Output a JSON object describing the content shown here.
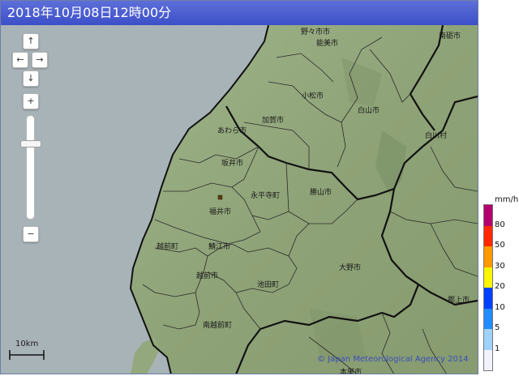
{
  "header": {
    "timestamp": "2018年10月08日12時00分"
  },
  "controls": {
    "pan_up": "↑",
    "pan_left": "←",
    "pan_right": "→",
    "pan_down": "↓",
    "zoom_in": "+",
    "zoom_out": "−",
    "zoom_level": 0.74
  },
  "scale": {
    "label": "10km"
  },
  "credit": "© Japan Meteorological Agency 2014",
  "legend": {
    "unit": "mm/h",
    "levels": [
      {
        "value": "80",
        "color": "#b4006e"
      },
      {
        "value": "50",
        "color": "#ff2800"
      },
      {
        "value": "30",
        "color": "#ff9900"
      },
      {
        "value": "20",
        "color": "#faf500"
      },
      {
        "value": "10",
        "color": "#0041ff"
      },
      {
        "value": "5",
        "color": "#218cff"
      },
      {
        "value": "1",
        "color": "#a0d2ff"
      },
      {
        "value": "",
        "color": "#f2f2ff"
      }
    ]
  },
  "places": [
    {
      "name": "能美市"
    },
    {
      "name": "南砺市"
    },
    {
      "name": "小松市"
    },
    {
      "name": "白山市"
    },
    {
      "name": "加賀市"
    },
    {
      "name": "あわら市"
    },
    {
      "name": "白川村"
    },
    {
      "name": "坂井市"
    },
    {
      "name": "永平寺町"
    },
    {
      "name": "勝山市"
    },
    {
      "name": "福井市"
    },
    {
      "name": "越前町"
    },
    {
      "name": "鯖江市"
    },
    {
      "name": "大野市"
    },
    {
      "name": "越前市"
    },
    {
      "name": "池田町"
    },
    {
      "name": "郡上市"
    },
    {
      "name": "南越前町"
    },
    {
      "name": "本巣市"
    },
    {
      "name": "野々市市"
    }
  ]
}
